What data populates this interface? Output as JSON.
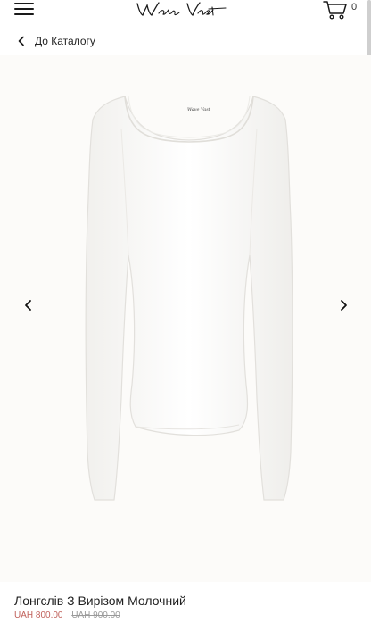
{
  "header": {
    "logo_text": "Wave Vast",
    "menu_icon": "hamburger-menu-icon",
    "cart_icon": "shopping-cart-icon",
    "cart_count": "0"
  },
  "nav": {
    "back_label": "До Каталогу",
    "back_icon": "chevron-left-icon"
  },
  "gallery": {
    "image_alt": "Лонгслів з вирізом молочний",
    "image_logo_text": "Wave Vast",
    "prev_icon": "chevron-left-icon",
    "next_icon": "chevron-right-icon"
  },
  "product": {
    "title": "Лонгслів З Вирізом Молочний",
    "price_sale": "UAH 800.00",
    "price_old": "UAH 900.00",
    "sale_color": "#c0605a"
  }
}
